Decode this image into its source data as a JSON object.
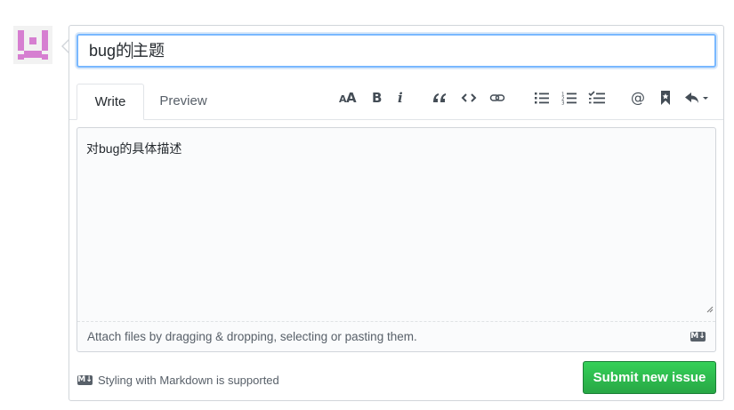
{
  "avatar": {
    "alt": "user avatar",
    "color": "#d67fd1"
  },
  "issue": {
    "title_before_caret": "bug的",
    "title_after_caret": "主题",
    "body": "对bug的具体描述"
  },
  "tabs": [
    {
      "label": "Write",
      "active": true
    },
    {
      "label": "Preview",
      "active": false
    }
  ],
  "toolbar": [
    {
      "name": "header-text-icon",
      "glyph": "AA"
    },
    {
      "name": "bold-icon",
      "glyph": "B"
    },
    {
      "name": "italic-icon",
      "glyph": "i"
    },
    {
      "name": "quote-icon",
      "glyph": "quote"
    },
    {
      "name": "code-icon",
      "glyph": "code"
    },
    {
      "name": "link-icon",
      "glyph": "link"
    },
    {
      "name": "unordered-list-icon",
      "glyph": "ul"
    },
    {
      "name": "ordered-list-icon",
      "glyph": "ol"
    },
    {
      "name": "task-list-icon",
      "glyph": "tasklist"
    },
    {
      "name": "mention-icon",
      "glyph": "@"
    },
    {
      "name": "saved-reply-icon",
      "glyph": "bookmark"
    },
    {
      "name": "reply-icon",
      "glyph": "reply"
    }
  ],
  "attach_hint": "Attach files by dragging & dropping, selecting or pasting them.",
  "markdown_badge": "M↓",
  "markdown_note": "Styling with Markdown is supported",
  "submit_label": "Submit new issue",
  "colors": {
    "accent": "#2188ff",
    "submit": "#28a745",
    "border": "#d1d5da"
  }
}
